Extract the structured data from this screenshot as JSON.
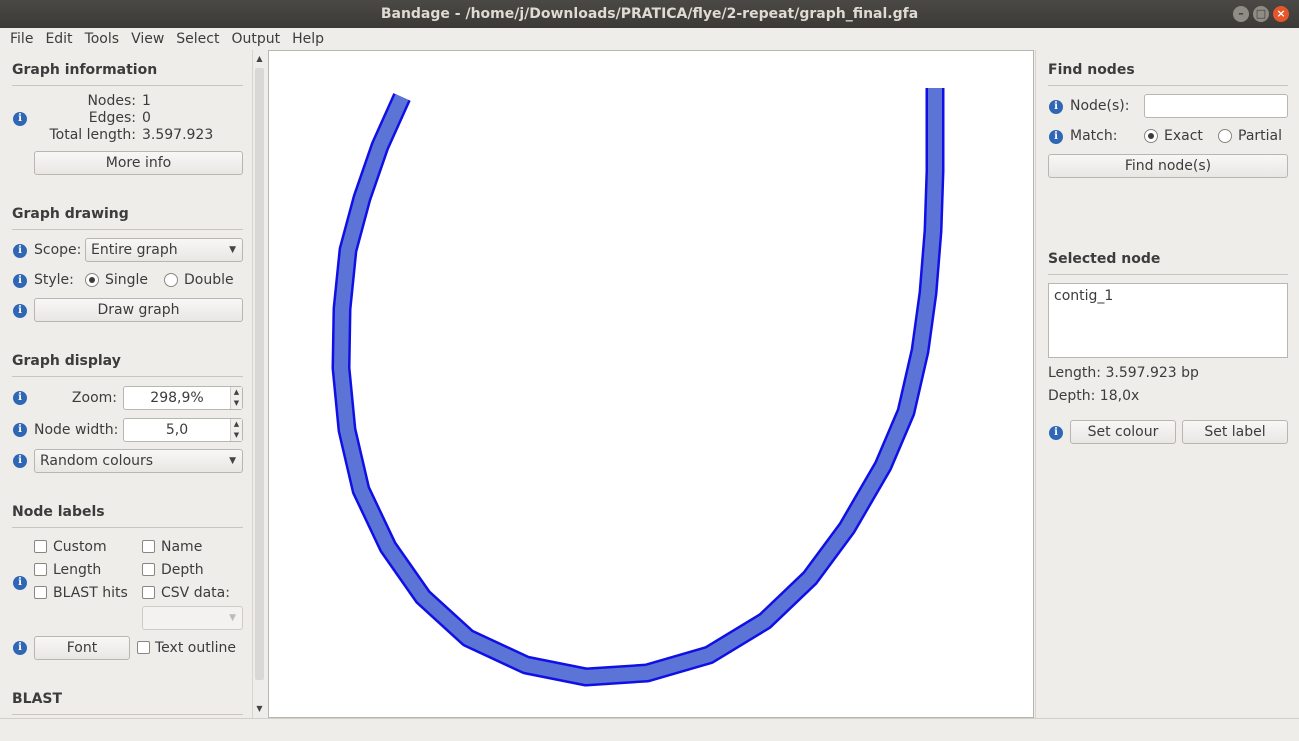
{
  "window": {
    "title": "Bandage - /home/j/Downloads/PRATICA/flye/2-repeat/graph_final.gfa"
  },
  "menu": [
    "File",
    "Edit",
    "Tools",
    "View",
    "Select",
    "Output",
    "Help"
  ],
  "graph_information": {
    "title": "Graph information",
    "nodes_label": "Nodes:",
    "nodes_value": "1",
    "edges_label": "Edges:",
    "edges_value": "0",
    "total_length_label": "Total length:",
    "total_length_value": "3.597.923",
    "more_info_button": "More info"
  },
  "graph_drawing": {
    "title": "Graph drawing",
    "scope_label": "Scope:",
    "scope_value": "Entire graph",
    "style_label": "Style:",
    "style_single": "Single",
    "style_double": "Double",
    "draw_button": "Draw graph"
  },
  "graph_display": {
    "title": "Graph display",
    "zoom_label": "Zoom:",
    "zoom_value": "298,9%",
    "node_width_label": "Node width:",
    "node_width_value": "5,0",
    "colour_scheme": "Random colours"
  },
  "node_labels": {
    "title": "Node labels",
    "custom": "Custom",
    "name": "Name",
    "length": "Length",
    "depth": "Depth",
    "blast_hits": "BLAST hits",
    "csv_data": "CSV data:",
    "font_button": "Font",
    "text_outline": "Text outline"
  },
  "blast": {
    "title": "BLAST"
  },
  "find_nodes": {
    "title": "Find nodes",
    "nodes_label": "Node(s):",
    "nodes_value": "",
    "match_label": "Match:",
    "exact": "Exact",
    "partial": "Partial",
    "find_button": "Find node(s)"
  },
  "selected_node": {
    "title": "Selected node",
    "name": "contig_1",
    "length": "Length: 3.597.923 bp",
    "depth": "Depth: 18,0x",
    "set_colour_button": "Set colour",
    "set_label_button": "Set label"
  },
  "colors": {
    "node_fill": "#5c74d6",
    "node_stroke": "#1010e6"
  }
}
